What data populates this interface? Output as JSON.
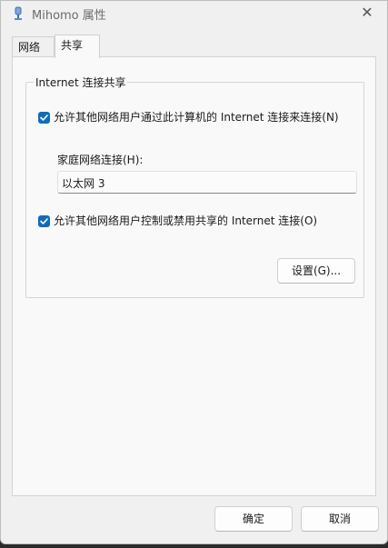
{
  "window": {
    "title": "Mihomo 属性",
    "close_symbol": "✕"
  },
  "tabs": [
    {
      "label": "网络",
      "active": false
    },
    {
      "label": "共享",
      "active": true
    }
  ],
  "sharing": {
    "group_title": "Internet 连接共享",
    "allow_share_label": "允许其他网络用户通过此计算机的 Internet 连接来连接(N)",
    "allow_share_checked": true,
    "home_network_label": "家庭网络连接(H):",
    "home_network_value": "以太网 3",
    "allow_control_label": "允许其他网络用户控制或禁用共享的 Internet 连接(O)",
    "allow_control_checked": true,
    "settings_button": "设置(G)..."
  },
  "footer": {
    "ok_button": "确定",
    "cancel_button": "取消"
  },
  "colors": {
    "accent": "#0f6cbd",
    "window_bg": "#f0f0f0",
    "panel_bg": "#f9f9f9"
  }
}
